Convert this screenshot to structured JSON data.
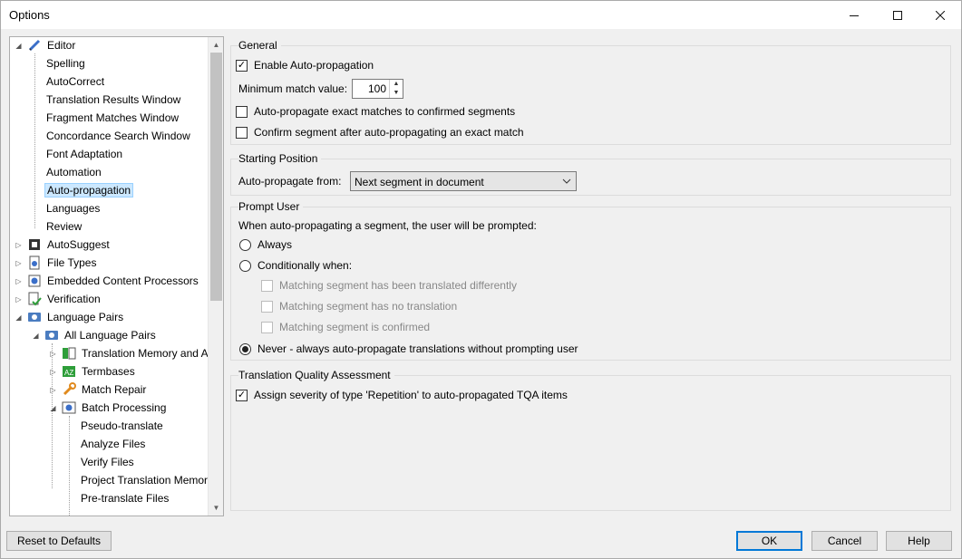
{
  "window": {
    "title": "Options"
  },
  "tree": {
    "items": [
      {
        "label": "Editor"
      },
      {
        "label": "Spelling"
      },
      {
        "label": "AutoCorrect"
      },
      {
        "label": "Translation Results Window"
      },
      {
        "label": "Fragment Matches Window"
      },
      {
        "label": "Concordance Search Window"
      },
      {
        "label": "Font Adaptation"
      },
      {
        "label": "Automation"
      },
      {
        "label": "Auto-propagation"
      },
      {
        "label": "Languages"
      },
      {
        "label": "Review"
      },
      {
        "label": "AutoSuggest"
      },
      {
        "label": "File Types"
      },
      {
        "label": "Embedded Content Processors"
      },
      {
        "label": "Verification"
      },
      {
        "label": "Language Pairs"
      },
      {
        "label": "All Language Pairs"
      },
      {
        "label": "Translation Memory and A"
      },
      {
        "label": "Termbases"
      },
      {
        "label": "Match Repair"
      },
      {
        "label": "Batch Processing"
      },
      {
        "label": "Pseudo-translate"
      },
      {
        "label": "Analyze Files"
      },
      {
        "label": "Verify Files"
      },
      {
        "label": "Project Translation Memori"
      },
      {
        "label": "Pre-translate Files"
      }
    ]
  },
  "general": {
    "title": "General",
    "enable_label": "Enable Auto-propagation",
    "min_match_label": "Minimum match value:",
    "min_match_value": "100",
    "exact_matches_label": "Auto-propagate exact matches to confirmed segments",
    "confirm_label": "Confirm segment after auto-propagating an exact match"
  },
  "starting": {
    "title": "Starting Position",
    "from_label": "Auto-propagate from:",
    "from_value": "Next segment in document"
  },
  "prompt": {
    "title": "Prompt User",
    "description": "When auto-propagating a segment, the user will be prompted:",
    "always_label": "Always",
    "conditionally_label": "Conditionally when:",
    "cond1_label": "Matching segment has been translated differently",
    "cond2_label": "Matching segment has no translation",
    "cond3_label": "Matching segment is confirmed",
    "never_label": "Never - always auto-propagate translations without prompting user"
  },
  "tqa": {
    "title": "Translation Quality Assessment",
    "assign_label": "Assign severity of type 'Repetition' to auto-propagated TQA items"
  },
  "footer": {
    "reset_label": "Reset to Defaults",
    "ok_label": "OK",
    "cancel_label": "Cancel",
    "help_label": "Help"
  }
}
